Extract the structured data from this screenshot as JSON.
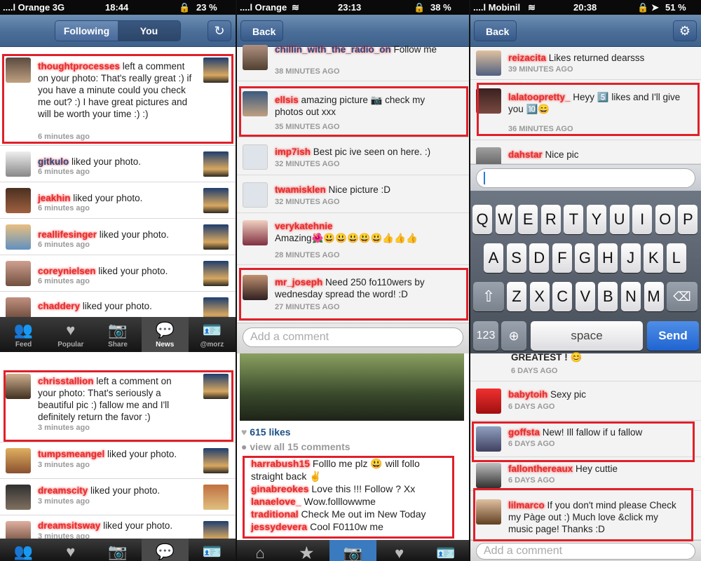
{
  "panel1": {
    "status": {
      "carrier": "....l Orange  3G",
      "time": "18:44",
      "battery": "23 %"
    },
    "segments": [
      "Following",
      "You"
    ],
    "rows": [
      {
        "user": "thoughtprocesses",
        "text": " left a comment on your photo: That's really great :) if you have a minute could you check me out? :) I have great pictures and will be worth your time :) :)",
        "time": "6 minutes ago"
      },
      {
        "user": "gitkulo",
        "text": " liked your photo.",
        "time": "6 minutes ago"
      },
      {
        "user": "jeakhin",
        "text": " liked your photo.",
        "time": "6 minutes ago"
      },
      {
        "user": "reallifesinger",
        "text": " liked your photo.",
        "time": "6 minutes ago"
      },
      {
        "user": "coreynielsen",
        "text": " liked your photo.",
        "time": "6 minutes ago"
      },
      {
        "user": "chaddery",
        "text": " liked your photo.",
        "time": ""
      }
    ],
    "tabs": [
      "Feed",
      "Popular",
      "Share",
      "News",
      "@morz"
    ],
    "rows2": [
      {
        "user": "chrisstallion",
        "text": " left a comment on your photo: That's seriously a beautiful pic :) fallow me and I'll definitely return the favor :)",
        "time": "3 minutes ago"
      },
      {
        "user": "tumpsmeangel",
        "text": " liked your photo.",
        "time": "3 minutes ago"
      },
      {
        "user": "dreamscity",
        "text": " liked your photo.",
        "time": "3 minutes ago"
      },
      {
        "user": "dreamsitsway",
        "text": " liked your photo.",
        "time": "3 minutes ago"
      }
    ]
  },
  "panel2": {
    "status": {
      "carrier": "....l Orange",
      "time": "23:13",
      "battery": "38 %"
    },
    "back": "Back",
    "rows": [
      {
        "user": "chillin_with_the_radio_on",
        "text": " Follow me",
        "time": "38 MINUTES AGO"
      },
      {
        "user": "ellsis",
        "text": " amazing picture 📷  check my photos out xxx",
        "time": "35 MINUTES AGO"
      },
      {
        "user": "imp7ish",
        "text": " Best pic ive seen on here. :)",
        "time": "32 MINUTES AGO"
      },
      {
        "user": "twamisklen",
        "text": " Nice picture :D",
        "time": "32 MINUTES AGO"
      },
      {
        "user": "verykatehnie",
        "text": " Amazing🌺😃😃😃😃😃👍👍👍",
        "time": "28 MINUTES AGO"
      },
      {
        "user": "mr_joseph",
        "text": " Need 250 fo110wers by wednesday spread the word! :D",
        "time": "27 MINUTES AGO"
      }
    ],
    "comment_placeholder": "Add a comment",
    "likes": "615 likes",
    "view_all": "view all 15 comments",
    "comments": [
      {
        "user": "harrabush15",
        "text": " Folllo me plz 😃 will follo straight back ✌"
      },
      {
        "user": "ginabreokes",
        "text": " Love this !!! Follow ? Xx"
      },
      {
        "user": "lanaelove_",
        "text": " Wow.folllowwme"
      },
      {
        "user": "traditional",
        "text": " Check Me out im New Today"
      },
      {
        "user": "jessydevera",
        "text": " Cool F0110w me"
      }
    ]
  },
  "panel3": {
    "status": {
      "carrier": "....l Mobinil",
      "time": "20:38",
      "battery": "51 %"
    },
    "back": "Back",
    "rows": [
      {
        "user": "reizacita",
        "text": " Likes returned dearsss",
        "time": "39 MINUTES AGO"
      },
      {
        "user": "lalatoopretty_",
        "text": " Heyy 5️⃣ likes and I'll give you 🔟😄",
        "time": "36 MINUTES AGO"
      },
      {
        "user": "dahstar",
        "text": " Nice pic",
        "time": ""
      }
    ],
    "keys_row1": [
      "Q",
      "W",
      "E",
      "R",
      "T",
      "Y",
      "U",
      "I",
      "O",
      "P"
    ],
    "keys_row2": [
      "A",
      "S",
      "D",
      "F",
      "G",
      "H",
      "J",
      "K",
      "L"
    ],
    "keys_row3": [
      "Z",
      "X",
      "C",
      "V",
      "B",
      "N",
      "M"
    ],
    "key_123": "123",
    "key_space": "space",
    "key_send": "Send",
    "rows2": [
      {
        "user": "",
        "text": "GREATEST ! 😊",
        "time": "6 DAYS AGO"
      },
      {
        "user": "babytoih",
        "text": " Sexy pic",
        "time": "6 DAYS AGO"
      },
      {
        "user": "goffsta",
        "text": " New! Ill fallow if u fallow",
        "time": "6 DAYS AGO"
      },
      {
        "user": "fallonthereaux",
        "text": " Hey cuttie",
        "time": "6 DAYS AGO"
      },
      {
        "user": "lilmarco",
        "text": " If you don't mind please Check my Pàge out :) Much love &click my music page! Thanks :D",
        "time": ""
      }
    ],
    "comment_placeholder": "Add a comment"
  }
}
